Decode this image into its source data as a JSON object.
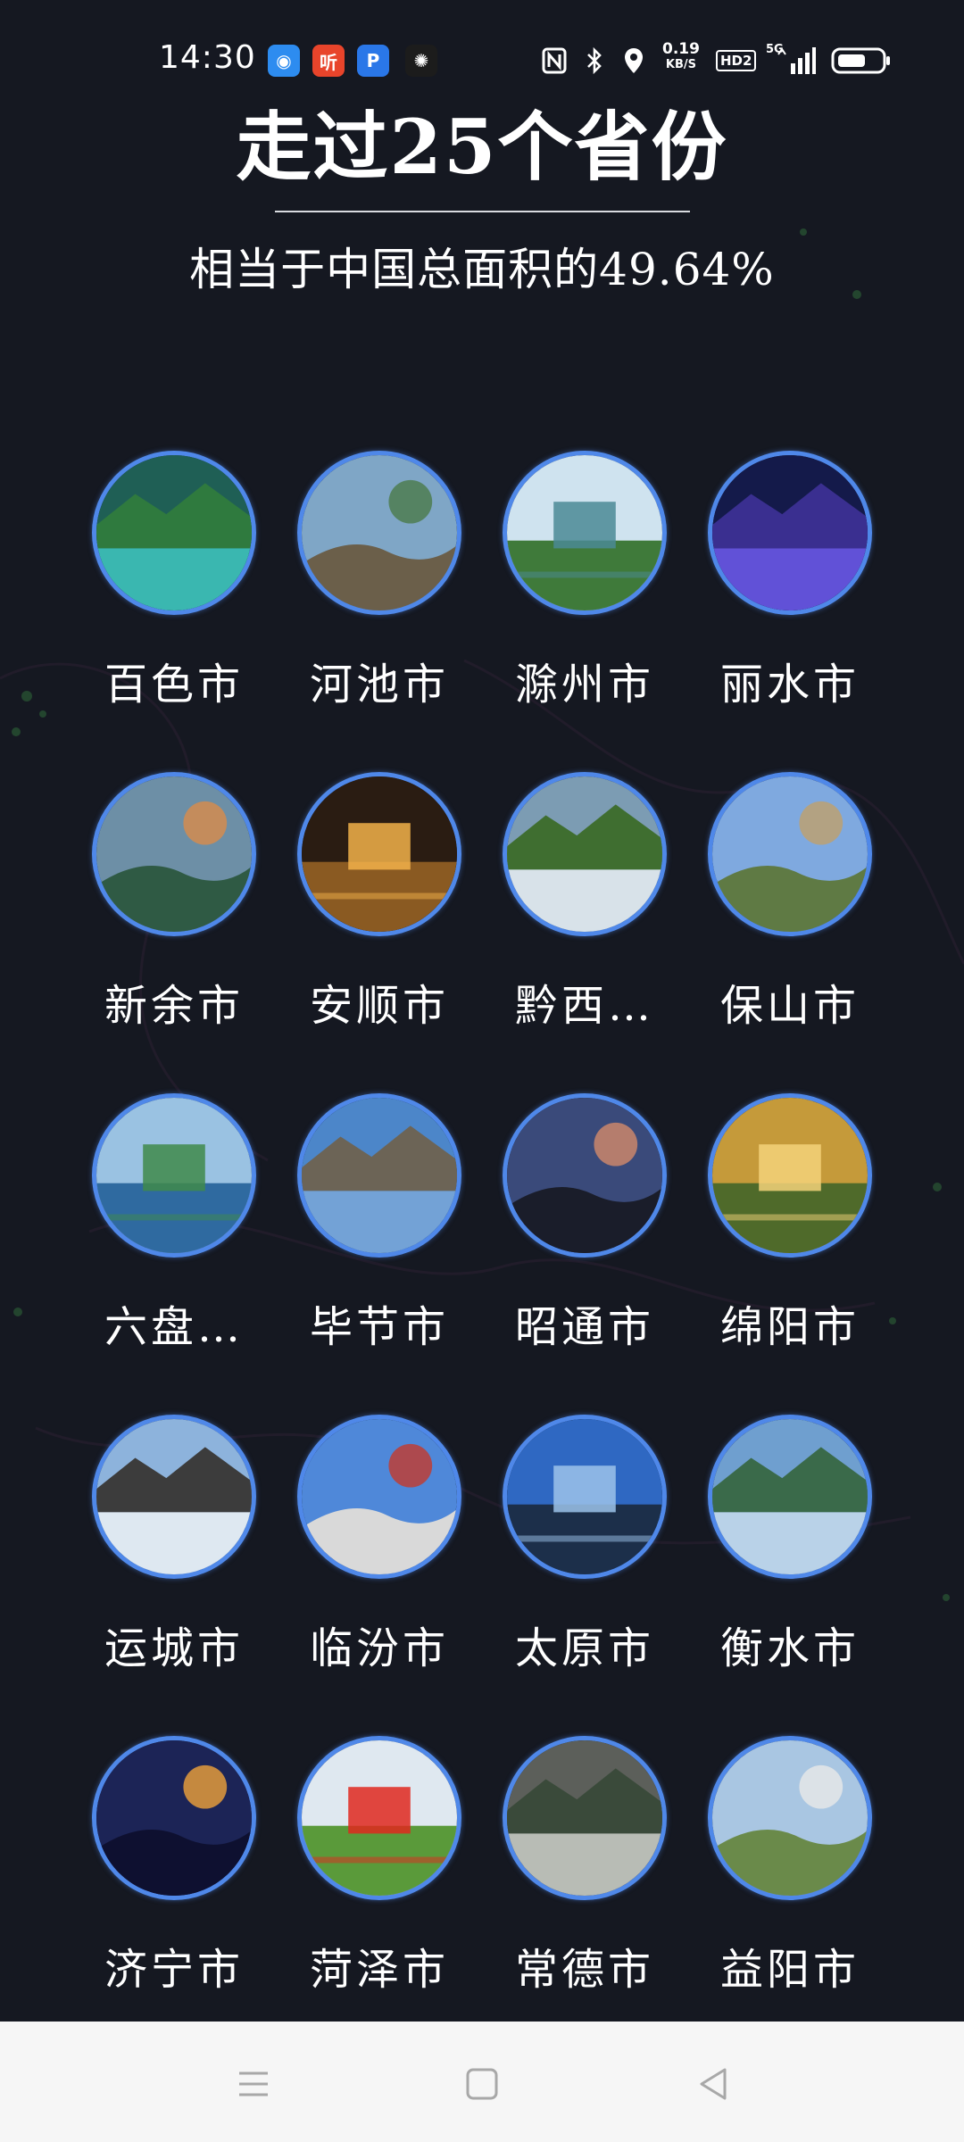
{
  "status_bar": {
    "time": "14:30",
    "app_icons": [
      {
        "name": "browser-app-icon",
        "glyph": "◉",
        "color": "#2d8cf0"
      },
      {
        "name": "listen-app-icon",
        "glyph": "听",
        "color": "#e8442b"
      },
      {
        "name": "p-app-icon",
        "glyph": "P",
        "color": "#2a77e8"
      },
      {
        "name": "pinwheel-app-icon",
        "glyph": "✺",
        "color": "#1c1c1c"
      }
    ],
    "net_speed_value": "0.19",
    "net_speed_unit": "KB/S",
    "hd_label": "HD2",
    "network_label": "5G"
  },
  "header": {
    "title": "走过25个省份",
    "subtitle": "相当于中国总面积的49.64%"
  },
  "cities": [
    {
      "name": "百色市",
      "bg": "#1f5f55",
      "accent": "#3fc7c1",
      "mid": "#2f7a3e"
    },
    {
      "name": "河池市",
      "bg": "#7fa6c6",
      "accent": "#4b7a48",
      "mid": "#6b5f4a"
    },
    {
      "name": "滁州市",
      "bg": "#cfe3ef",
      "accent": "#4b8a95",
      "mid": "#3f7a3a"
    },
    {
      "name": "丽水市",
      "bg": "#141a4a",
      "accent": "#6e5cf0",
      "mid": "#3a2f90"
    },
    {
      "name": "新余市",
      "bg": "#6d8fa6",
      "accent": "#d98b4a",
      "mid": "#2f5a44"
    },
    {
      "name": "安顺市",
      "bg": "#2a1c12",
      "accent": "#f2b24a",
      "mid": "#8a5a22"
    },
    {
      "name": "黔西…",
      "bg": "#7c9cb3",
      "accent": "#e9eef2",
      "mid": "#3f6e30"
    },
    {
      "name": "保山市",
      "bg": "#7fa9df",
      "accent": "#c0a06a",
      "mid": "#5f7a44"
    },
    {
      "name": "六盘…",
      "bg": "#9ac2e2",
      "accent": "#3f8a4a",
      "mid": "#2f6aa0"
    },
    {
      "name": "毕节市",
      "bg": "#4c86c9",
      "accent": "#7aa7d8",
      "mid": "#6c6456"
    },
    {
      "name": "昭通市",
      "bg": "#3a4a7a",
      "accent": "#d48a6a",
      "mid": "#1a1d2a"
    },
    {
      "name": "绵阳市",
      "bg": "#c59a3a",
      "accent": "#f3d27a",
      "mid": "#4f6a2a"
    },
    {
      "name": "运城市",
      "bg": "#8db3dc",
      "accent": "#ecf1f5",
      "mid": "#3c3c3c"
    },
    {
      "name": "临汾市",
      "bg": "#4f88d9",
      "accent": "#c43a2a",
      "mid": "#d9d9d9"
    },
    {
      "name": "太原市",
      "bg": "#2f68c2",
      "accent": "#9cc3ea",
      "mid": "#1c2f4a"
    },
    {
      "name": "衡水市",
      "bg": "#6f9fcf",
      "accent": "#c7dbec",
      "mid": "#3a6a4a"
    },
    {
      "name": "济宁市",
      "bg": "#1c2456",
      "accent": "#f0a23a",
      "mid": "#0e1030"
    },
    {
      "name": "菏泽市",
      "bg": "#dfe8f0",
      "accent": "#e0281e",
      "mid": "#5a9a3a"
    },
    {
      "name": "常德市",
      "bg": "#5c5f5a",
      "accent": "#c8ccc6",
      "mid": "#3a4a3a"
    },
    {
      "name": "益阳市",
      "bg": "#a9c6e2",
      "accent": "#e9e9e9",
      "mid": "#6a8a4a"
    }
  ],
  "nav_bar": {
    "menu_icon": "menu-icon",
    "home_icon": "home-icon",
    "back_icon": "back-icon"
  }
}
